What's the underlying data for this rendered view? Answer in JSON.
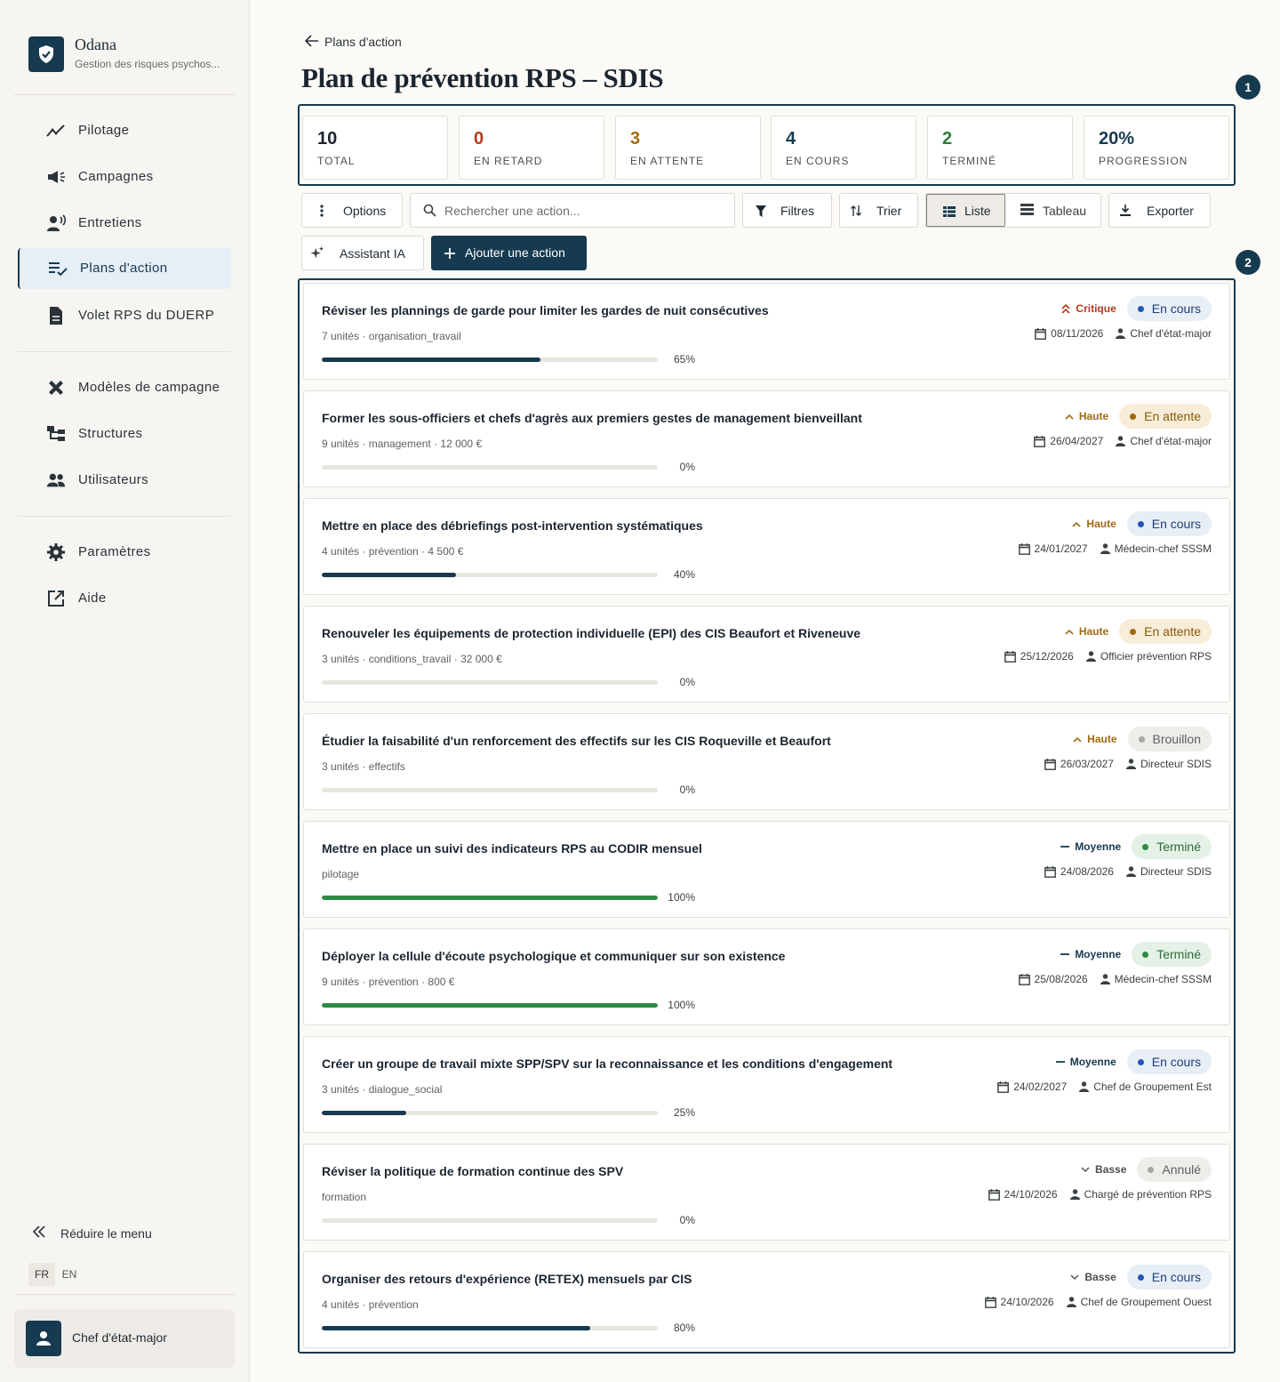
{
  "brand": {
    "name": "Odana",
    "subtitle": "Gestion des risques psychos..."
  },
  "nav": {
    "pilotage": "Pilotage",
    "campagnes": "Campagnes",
    "entretiens": "Entretiens",
    "plans": "Plans d'action",
    "volet": "Volet RPS du DUERP",
    "modeles": "Modèles de campagne",
    "structures": "Structures",
    "utilisateurs": "Utilisateurs",
    "parametres": "Paramètres",
    "aide": "Aide"
  },
  "sidebar_footer": {
    "collapse": "Réduire le menu",
    "lang_fr": "FR",
    "lang_en": "EN",
    "user": "Chef d'état-major"
  },
  "breadcrumb": "Plans d'action",
  "page_title": "Plan de prévention RPS – SDIS",
  "markers": [
    "1",
    "2"
  ],
  "stats": [
    {
      "value": "10",
      "label": "TOTAL",
      "color": "#1b2530"
    },
    {
      "value": "0",
      "label": "EN RETARD",
      "color": "#b23a1f"
    },
    {
      "value": "3",
      "label": "EN ATTENTE",
      "color": "#a06a12"
    },
    {
      "value": "4",
      "label": "EN COURS",
      "color": "#163a4f"
    },
    {
      "value": "2",
      "label": "TERMINÉ",
      "color": "#2e7d3a"
    },
    {
      "value": "20%",
      "label": "PROGRESSION",
      "color": "#163a4f"
    }
  ],
  "toolbar": {
    "options": "Options",
    "search_placeholder": "Rechercher une action...",
    "filters": "Filtres",
    "sort": "Trier",
    "view_list": "Liste",
    "view_board": "Tableau",
    "export": "Exporter",
    "assistant": "Assistant IA",
    "add": "Ajouter une action"
  },
  "colors": {
    "accent": "#163a4f",
    "progress_green": "#2e8b45",
    "progress_blue": "#163a4f"
  },
  "actions": [
    {
      "title": "Réviser les plannings de garde pour limiter les gardes de nuit consécutives",
      "meta": "7 unités · organisation_travail",
      "progress": 65,
      "progress_label": "65%",
      "priority": "Critique",
      "priority_icon": "double-chevron-up-icon",
      "status": "En cours",
      "date": "08/11/2026",
      "owner": "Chef d'état-major"
    },
    {
      "title": "Former les sous-officiers et chefs d'agrès aux premiers gestes de management bienveillant",
      "meta": "9 unités · management · 12 000 €",
      "progress": 0,
      "progress_label": "0%",
      "priority": "Haute",
      "priority_icon": "chevron-up-icon",
      "status": "En attente",
      "date": "26/04/2027",
      "owner": "Chef d'état-major"
    },
    {
      "title": "Mettre en place des débriefings post-intervention systématiques",
      "meta": "4 unités · prévention · 4 500 €",
      "progress": 40,
      "progress_label": "40%",
      "priority": "Haute",
      "priority_icon": "chevron-up-icon",
      "status": "En cours",
      "date": "24/01/2027",
      "owner": "Médecin-chef SSSM"
    },
    {
      "title": "Renouveler les équipements de protection individuelle (EPI) des CIS Beaufort et Riveneuve",
      "meta": "3 unités · conditions_travail · 32 000 €",
      "progress": 0,
      "progress_label": "0%",
      "priority": "Haute",
      "priority_icon": "chevron-up-icon",
      "status": "En attente",
      "date": "25/12/2026",
      "owner": "Officier prévention RPS"
    },
    {
      "title": "Étudier la faisabilité d'un renforcement des effectifs sur les CIS Roqueville et Beaufort",
      "meta": "3 unités · effectifs",
      "progress": 0,
      "progress_label": "0%",
      "priority": "Haute",
      "priority_icon": "chevron-up-icon",
      "status": "Brouillon",
      "date": "26/03/2027",
      "owner": "Directeur SDIS"
    },
    {
      "title": "Mettre en place un suivi des indicateurs RPS au CODIR mensuel",
      "meta": "pilotage",
      "progress": 100,
      "progress_label": "100%",
      "priority": "Moyenne",
      "priority_icon": "minus-icon",
      "status": "Terminé",
      "date": "24/08/2026",
      "owner": "Directeur SDIS"
    },
    {
      "title": "Déployer la cellule d'écoute psychologique et communiquer sur son existence",
      "meta": "9 unités · prévention · 800 €",
      "progress": 100,
      "progress_label": "100%",
      "priority": "Moyenne",
      "priority_icon": "minus-icon",
      "status": "Terminé",
      "date": "25/08/2026",
      "owner": "Médecin-chef SSSM"
    },
    {
      "title": "Créer un groupe de travail mixte SPP/SPV sur la reconnaissance et les conditions d'engagement",
      "meta": "3 unités · dialogue_social",
      "progress": 25,
      "progress_label": "25%",
      "priority": "Moyenne",
      "priority_icon": "minus-icon",
      "status": "En cours",
      "date": "24/02/2027",
      "owner": "Chef de Groupement Est"
    },
    {
      "title": "Réviser la politique de formation continue des SPV",
      "meta": "formation",
      "progress": 0,
      "progress_label": "0%",
      "priority": "Basse",
      "priority_icon": "chevron-down-icon",
      "status": "Annulé",
      "date": "24/10/2026",
      "owner": "Chargé de prévention RPS"
    },
    {
      "title": "Organiser des retours d'expérience (RETEX) mensuels par CIS",
      "meta": "4 unités · prévention",
      "progress": 80,
      "progress_label": "80%",
      "priority": "Basse",
      "priority_icon": "chevron-down-icon",
      "status": "En cours",
      "date": "24/10/2026",
      "owner": "Chef de Groupement Ouest"
    }
  ]
}
